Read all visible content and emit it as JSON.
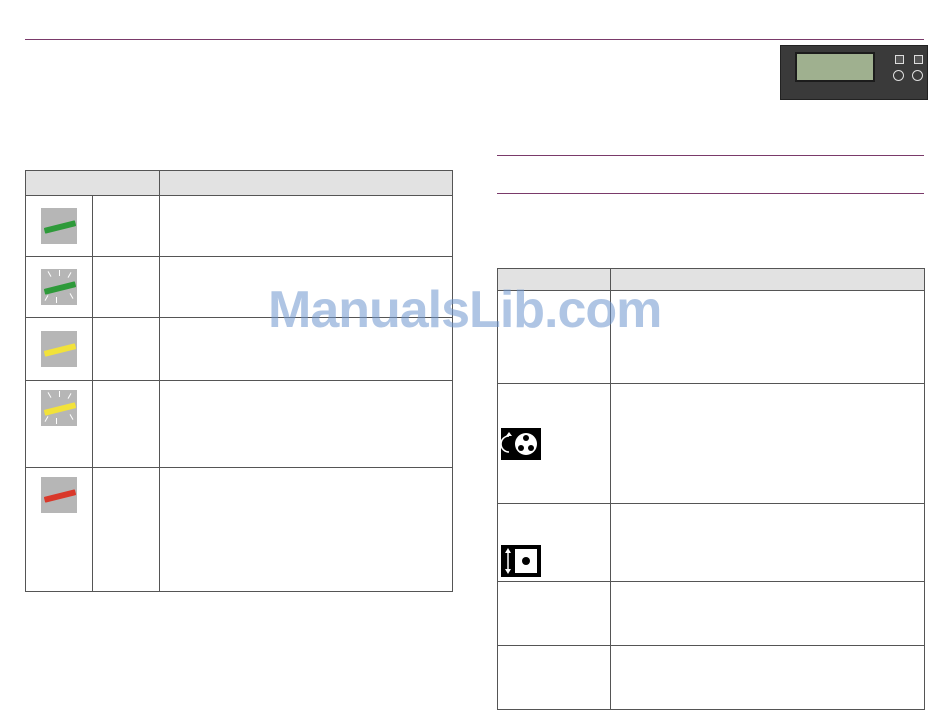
{
  "watermark": "ManualsLib.com",
  "colors": {
    "rule": "#7a3a6a",
    "header_bg": "#e2e2e2",
    "led_green": "#2e9a3a",
    "led_yellow": "#f2e23a",
    "led_red": "#d9382a"
  },
  "left_table": {
    "rows": [
      {
        "icon": "green-led-steady-icon"
      },
      {
        "icon": "green-led-blinking-icon"
      },
      {
        "icon": "yellow-led-steady-icon"
      },
      {
        "icon": "yellow-led-blinking-icon"
      },
      {
        "icon": "red-led-steady-icon"
      }
    ]
  },
  "right_table": {
    "rows": [
      {
        "icon": ""
      },
      {
        "icon": "reel-rotate-icon"
      },
      {
        "icon": "disc-vertical-move-icon"
      },
      {
        "icon": ""
      },
      {
        "icon": ""
      }
    ]
  },
  "panel_image": {
    "icon": "control-panel-lcd-icon"
  }
}
